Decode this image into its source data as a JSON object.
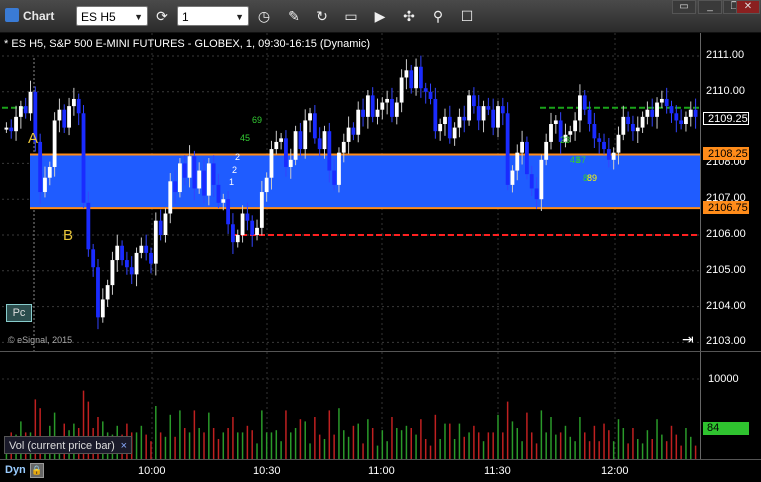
{
  "window": {
    "title": "Chart"
  },
  "toolbar": {
    "symbol": "ES H5",
    "interval": "1",
    "tools": [
      "cycle-icon",
      "clock-icon",
      "pencil-icon",
      "curve-icon",
      "template-icon",
      "play-icon",
      "compass-icon",
      "pin-icon",
      "chat-icon"
    ]
  },
  "chart": {
    "title": "* ES H5, S&P 500 E-MINI FUTURES - GLOBEX, 1, 09:30-16:15 (Dynamic)",
    "copyright": "© eSignal, 2015",
    "pc_label": "Pc",
    "y_ticks": [
      "2111.00",
      "2110.00",
      "2108.00",
      "2107.00",
      "2106.00",
      "2105.00",
      "2104.00",
      "2103.00"
    ],
    "price_tags": [
      {
        "label": "2109.25",
        "kind": "last"
      },
      {
        "label": "2108.25",
        "kind": "upper"
      },
      {
        "label": "2106.75",
        "kind": "lower"
      }
    ],
    "annotations": [
      "A",
      "B"
    ],
    "marks": [
      "45",
      "69",
      "23",
      "43",
      "67",
      "89",
      "2",
      "2",
      "1",
      "8"
    ],
    "x_ticks": [
      "10:00",
      "10:30",
      "11:00",
      "11:30",
      "12:00"
    ],
    "dyn_label": "Dyn"
  },
  "volume": {
    "tab_label": "Vol (current price bar)",
    "close_glyph": "×",
    "tick": "10000",
    "last_tag": "84"
  },
  "colors": {
    "band": "#1f5cff",
    "up": "#ffffff",
    "down": "#1a2bff",
    "upper_line": "#ff8c1a",
    "red_dash": "#ff2020",
    "green_dash": "#1aa31a",
    "last_tag": "#2fc22f"
  },
  "chart_data": {
    "type": "candlestick",
    "title": "* ES H5, S&P 500 E-MINI FUTURES - GLOBEX, 1, 09:30-16:15 (Dynamic)",
    "ylim": [
      2103,
      2111.5
    ],
    "x_ticks": [
      "10:00",
      "10:30",
      "11:00",
      "11:30",
      "12:00"
    ],
    "levels": {
      "last": 2109.25,
      "range_high": 2108.25,
      "range_low": 2106.75,
      "red_dashed": 2106.0,
      "green_dashed": 2109.5
    },
    "closes": [
      2109.0,
      2108.9,
      2109.3,
      2109.6,
      2109.4,
      2110.0,
      2108.6,
      2107.2,
      2107.6,
      2107.9,
      2109.2,
      2109.5,
      2109.0,
      2109.6,
      2109.8,
      2109.4,
      2106.9,
      2105.6,
      2105.1,
      2103.7,
      2104.2,
      2104.6,
      2105.3,
      2105.7,
      2105.3,
      2105.1,
      2104.9,
      2105.5,
      2105.7,
      2105.5,
      2105.2,
      2106.4,
      2106.0,
      2106.6,
      2107.5,
      2107.2,
      2108.0,
      2107.6,
      2108.2,
      2107.3,
      2107.8,
      2107.1,
      2108.0,
      2107.4,
      2106.9,
      2107.0,
      2106.3,
      2105.8,
      2106.0,
      2106.6,
      2106.4,
      2106.0,
      2106.2,
      2107.2,
      2107.6,
      2108.4,
      2108.6,
      2108.7,
      2107.9,
      2108.1,
      2108.9,
      2108.4,
      2109.2,
      2109.4,
      2108.7,
      2108.4,
      2108.9,
      2107.8,
      2107.4,
      2108.3,
      2108.6,
      2109.0,
      2108.8,
      2109.5,
      2109.3,
      2109.9,
      2109.3,
      2109.5,
      2109.7,
      2109.8,
      2109.3,
      2109.7,
      2110.4,
      2110.6,
      2110.1,
      2110.7,
      2110.1,
      2110.0,
      2109.8,
      2108.9,
      2109.1,
      2109.3,
      2108.7,
      2109.0,
      2109.3,
      2109.2,
      2109.9,
      2109.6,
      2109.2,
      2109.6,
      2109.5,
      2109.0,
      2109.6,
      2109.4,
      2107.4,
      2107.8,
      2108.3,
      2108.6,
      2107.7,
      2107.3,
      2107.0,
      2108.1,
      2108.6,
      2109.1,
      2109.2,
      2108.6,
      2108.8,
      2108.9,
      2109.2,
      2109.9,
      2109.5,
      2109.1,
      2108.7,
      2108.6,
      2108.4,
      2108.1,
      2108.3,
      2108.8,
      2109.3,
      2109.1,
      2108.9,
      2109.0,
      2109.3,
      2109.5,
      2109.3,
      2109.7,
      2109.8,
      2109.6,
      2109.4,
      2109.2,
      2109.1,
      2109.3,
      2109.5,
      2109.3
    ]
  }
}
